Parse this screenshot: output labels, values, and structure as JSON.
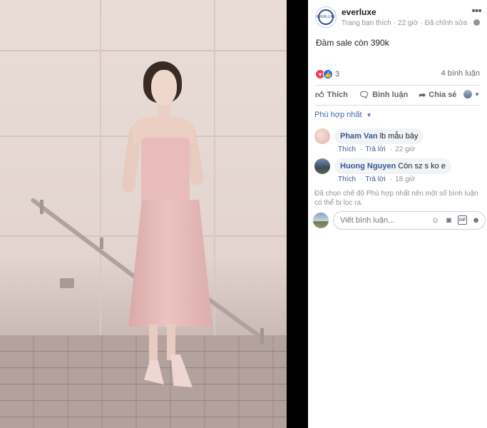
{
  "post": {
    "page_name": "everluxe",
    "avatar_text": "EVERLUXE",
    "liked_label": "Trang bạn thích",
    "time": "22 giờ",
    "edited_label": "Đã chỉnh sửa",
    "caption": "Đầm sale còn 390k"
  },
  "reactions": {
    "count": "3",
    "comments_count": "4 bình luận"
  },
  "actions": {
    "like": "Thích",
    "comment": "Bình luận",
    "share": "Chia sẻ"
  },
  "sort": {
    "label": "Phù hợp nhất"
  },
  "comments": [
    {
      "author": "Pham Van",
      "text": "lb mẫu bảy",
      "like": "Thích",
      "reply": "Trả lời",
      "time": "22 giờ"
    },
    {
      "author": "Huong Nguyen",
      "text": "Còn sz s ko e",
      "like": "Thích",
      "reply": "Trả lời",
      "time": "18 giờ"
    }
  ],
  "filter_note": "Đã chọn chế độ Phù hợp nhất nên một số bình luận có thể bị lọc ra.",
  "compose": {
    "placeholder": "Viết bình luận..."
  },
  "icons": {
    "more": "more-icon",
    "like": "thumbs-up-icon",
    "comment": "comment-icon",
    "share": "share-icon",
    "emoji": "emoji-icon",
    "camera": "camera-icon",
    "gif": "gif-icon",
    "sticker": "sticker-icon"
  },
  "colors": {
    "link": "#385898",
    "sort": "#4267b2",
    "love": "#f33e58",
    "like": "#1877f2"
  }
}
